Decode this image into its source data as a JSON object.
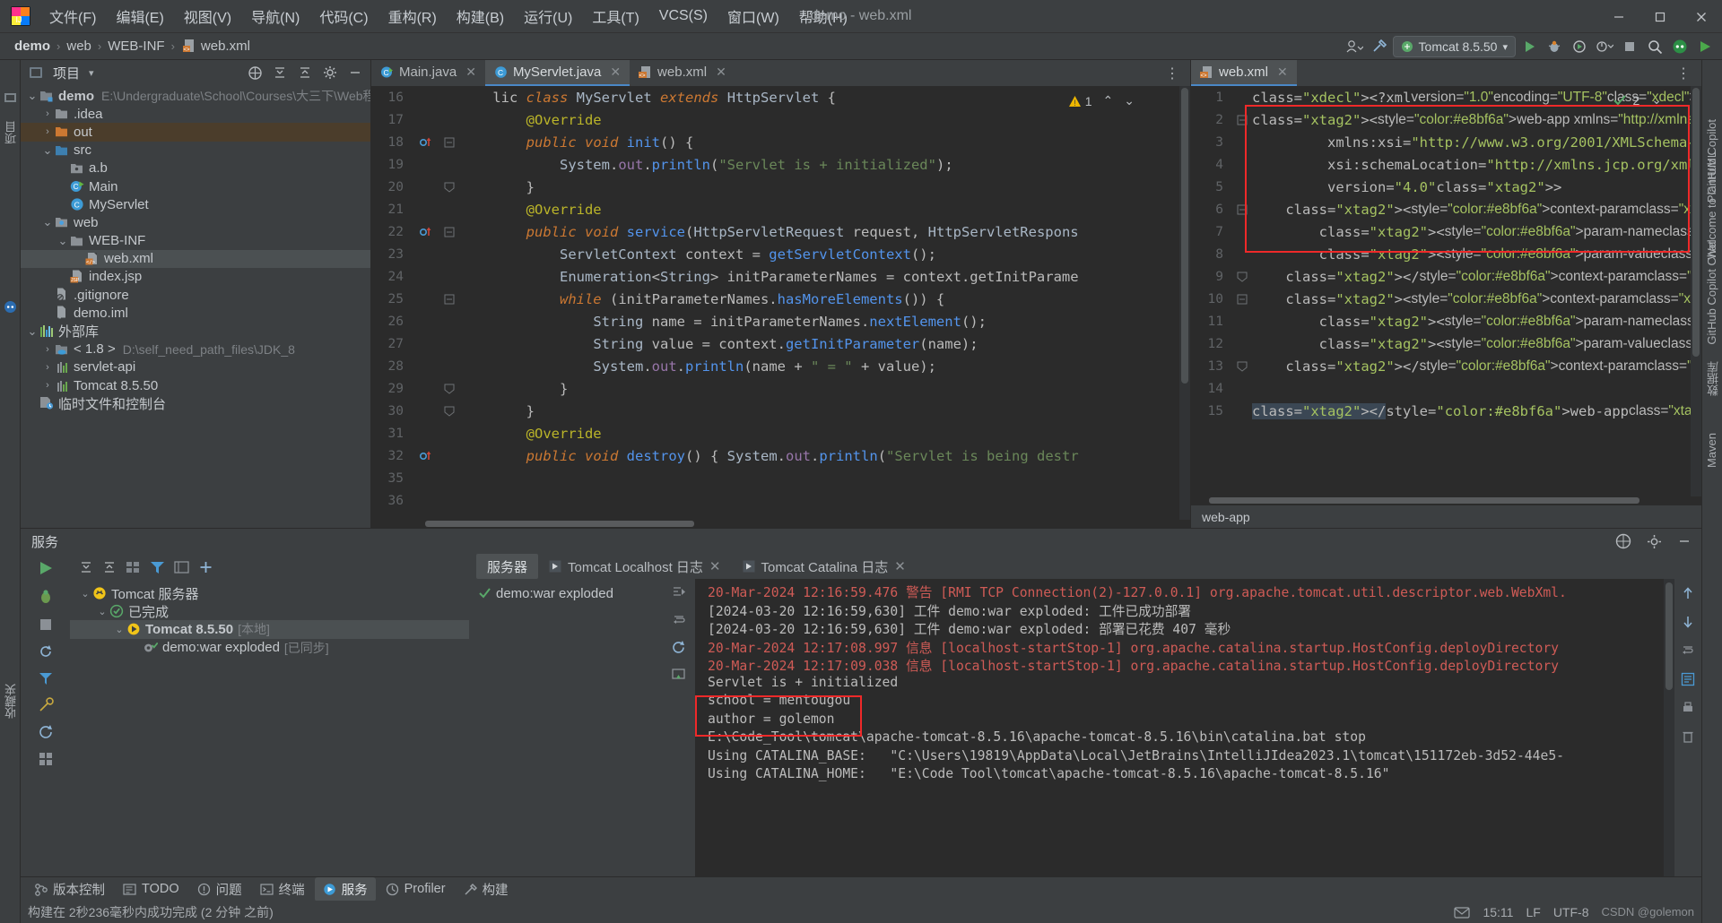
{
  "window": {
    "title": "demo - web.xml",
    "minimize": "—",
    "maximize": "❐",
    "close": "✕"
  },
  "menu": {
    "items": [
      {
        "label": "文件(F)",
        "name": "menu-file"
      },
      {
        "label": "编辑(E)",
        "name": "menu-edit"
      },
      {
        "label": "视图(V)",
        "name": "menu-view"
      },
      {
        "label": "导航(N)",
        "name": "menu-navigate"
      },
      {
        "label": "代码(C)",
        "name": "menu-code"
      },
      {
        "label": "重构(R)",
        "name": "menu-refactor"
      },
      {
        "label": "构建(B)",
        "name": "menu-build"
      },
      {
        "label": "运行(U)",
        "name": "menu-run"
      },
      {
        "label": "工具(T)",
        "name": "menu-tools"
      },
      {
        "label": "VCS(S)",
        "name": "menu-vcs"
      },
      {
        "label": "窗口(W)",
        "name": "menu-window"
      },
      {
        "label": "帮助(H)",
        "name": "menu-help"
      }
    ]
  },
  "navbar": {
    "crumbs": [
      "demo",
      "web",
      "WEB-INF",
      "web.xml"
    ],
    "separator": "›",
    "run_config": "Tomcat 8.5.50",
    "run_config_caret": "▾"
  },
  "left_strip": {
    "tabs": [
      "项目",
      "收藏夹"
    ]
  },
  "right_strip": {
    "tabs": [
      "Welcome to GitHub Copilot",
      "PlantUML",
      "GitHub Copilot Chat",
      "数据库",
      "Maven"
    ]
  },
  "project": {
    "title": "项目",
    "caret": "▾",
    "tree": [
      {
        "indent": 0,
        "arrow": "v",
        "icon": "module-folder",
        "label": "demo",
        "bold": true,
        "path": "E:\\Undergraduate\\School\\Courses\\大三下\\Web程序设计",
        "state": "normal"
      },
      {
        "indent": 1,
        "arrow": ">",
        "icon": "folder-gray",
        "label": ".idea",
        "path": "",
        "state": "normal"
      },
      {
        "indent": 1,
        "arrow": ">",
        "icon": "folder-orange",
        "label": "out",
        "path": "",
        "state": "excluded"
      },
      {
        "indent": 1,
        "arrow": "v",
        "icon": "folder-src",
        "label": "src",
        "path": "",
        "state": "normal"
      },
      {
        "indent": 2,
        "arrow": "",
        "icon": "package",
        "label": "a.b",
        "path": "",
        "state": "normal"
      },
      {
        "indent": 2,
        "arrow": "",
        "icon": "class-run",
        "label": "Main",
        "path": "",
        "state": "normal"
      },
      {
        "indent": 2,
        "arrow": "",
        "icon": "class",
        "label": "MyServlet",
        "path": "",
        "state": "normal"
      },
      {
        "indent": 1,
        "arrow": "v",
        "icon": "folder-web",
        "label": "web",
        "path": "",
        "state": "normal"
      },
      {
        "indent": 2,
        "arrow": "v",
        "icon": "folder-gray",
        "label": "WEB-INF",
        "path": "",
        "state": "normal"
      },
      {
        "indent": 3,
        "arrow": "",
        "icon": "xml-file",
        "label": "web.xml",
        "path": "",
        "state": "selected"
      },
      {
        "indent": 2,
        "arrow": "",
        "icon": "jsp-file",
        "label": "index.jsp",
        "path": "",
        "state": "normal"
      },
      {
        "indent": 1,
        "arrow": "",
        "icon": "gitignore-file",
        "label": ".gitignore",
        "path": "",
        "state": "normal"
      },
      {
        "indent": 1,
        "arrow": "",
        "icon": "iml-file",
        "label": "demo.iml",
        "path": "",
        "state": "normal"
      },
      {
        "indent": 0,
        "arrow": "v",
        "icon": "library-bars",
        "label": "外部库",
        "path": "",
        "state": "normal"
      },
      {
        "indent": 1,
        "arrow": ">",
        "icon": "jdk-folder",
        "label": "< 1.8 >",
        "path": "D:\\self_need_path_files\\JDK_8",
        "state": "normal"
      },
      {
        "indent": 1,
        "arrow": ">",
        "icon": "library-bars-sm",
        "label": "servlet-api",
        "path": "",
        "state": "normal"
      },
      {
        "indent": 1,
        "arrow": ">",
        "icon": "library-bars-sm",
        "label": "Tomcat 8.5.50",
        "path": "",
        "state": "normal"
      },
      {
        "indent": 0,
        "arrow": "",
        "icon": "scratch-file",
        "label": "临时文件和控制台",
        "path": "",
        "state": "normal"
      }
    ]
  },
  "editor_left": {
    "tabs": [
      {
        "label": "Main.java",
        "icon": "class-run-icon",
        "active": false
      },
      {
        "label": "MyServlet.java",
        "icon": "class-icon",
        "active": true
      },
      {
        "label": "web.xml",
        "icon": "xml-icon",
        "active": false
      }
    ],
    "warning_count": "1",
    "warning_up": "⌃",
    "warning_down": "⌄",
    "first_line_number": 16,
    "lines": [
      {
        "n": 16,
        "gutter": "",
        "fold": "",
        "text": "    lic class MyServlet extends HttpServlet {"
      },
      {
        "n": 17,
        "gutter": "",
        "fold": "",
        "text": "        @Override"
      },
      {
        "n": 18,
        "gutter": "override",
        "fold": "-",
        "text": "        public void init() {"
      },
      {
        "n": 19,
        "gutter": "",
        "fold": "",
        "text": "            System.out.println(\"Servlet is + initialized\");"
      },
      {
        "n": 20,
        "gutter": "",
        "fold": "+",
        "text": "        }"
      },
      {
        "n": 21,
        "gutter": "",
        "fold": "",
        "text": "        @Override"
      },
      {
        "n": 22,
        "gutter": "override",
        "fold": "-",
        "text": "        public void service(HttpServletRequest request, HttpServletRespons"
      },
      {
        "n": 23,
        "gutter": "",
        "fold": "",
        "text": "            ServletContext context = getServletContext();"
      },
      {
        "n": 24,
        "gutter": "",
        "fold": "",
        "text": "            Enumeration<String> initParameterNames = context.getInitParame"
      },
      {
        "n": 25,
        "gutter": "",
        "fold": "-",
        "text": "            while (initParameterNames.hasMoreElements()) {"
      },
      {
        "n": 26,
        "gutter": "",
        "fold": "",
        "text": "                String name = initParameterNames.nextElement();"
      },
      {
        "n": 27,
        "gutter": "",
        "fold": "",
        "text": "                String value = context.getInitParameter(name);"
      },
      {
        "n": 28,
        "gutter": "",
        "fold": "",
        "text": "                System.out.println(name + \" = \" + value);"
      },
      {
        "n": 29,
        "gutter": "",
        "fold": "+",
        "text": "            }"
      },
      {
        "n": 30,
        "gutter": "",
        "fold": "+",
        "text": "        }"
      },
      {
        "n": 31,
        "gutter": "",
        "fold": "",
        "text": "        @Override"
      },
      {
        "n": 32,
        "gutter": "override",
        "fold": "",
        "text": "        public void destroy() { System.out.println(\"Servlet is being destr"
      },
      {
        "n": 35,
        "gutter": "",
        "fold": "",
        "text": ""
      },
      {
        "n": 36,
        "gutter": "",
        "fold": "",
        "text": ""
      }
    ]
  },
  "editor_right": {
    "tabs": [
      {
        "label": "web.xml",
        "icon": "xml-icon",
        "active": true
      }
    ],
    "inspection_count": "2",
    "inspection_caret": "⌄",
    "breadcrumb": "web-app",
    "lines": [
      {
        "n": 1,
        "fold": "",
        "text": "<?xml version=\"1.0\" encoding=\"UTF-8\"?>"
      },
      {
        "n": 2,
        "fold": "-",
        "text": "<web-app xmlns=\"http://xmlns.jcp.org/xml/ns/javaee\""
      },
      {
        "n": 3,
        "fold": "",
        "text": "         xmlns:xsi=\"http://www.w3.org/2001/XMLSchema-instance\""
      },
      {
        "n": 4,
        "fold": "",
        "text": "         xsi:schemaLocation=\"http://xmlns.jcp.org/xml/ns/javaee http"
      },
      {
        "n": 5,
        "fold": "",
        "text": "         version=\"4.0\">"
      },
      {
        "n": 6,
        "fold": "-",
        "text": "    <context-param>"
      },
      {
        "n": 7,
        "fold": "",
        "text": "        <param-name>author</param-name>"
      },
      {
        "n": 8,
        "fold": "",
        "text": "        <param-value>golemon</param-value>"
      },
      {
        "n": 9,
        "fold": "+",
        "text": "    </context-param>"
      },
      {
        "n": 10,
        "fold": "-",
        "text": "    <context-param>"
      },
      {
        "n": 11,
        "fold": "",
        "text": "        <param-name>school</param-name>"
      },
      {
        "n": 12,
        "fold": "",
        "text": "        <param-value>mentougou</param-value>"
      },
      {
        "n": 13,
        "fold": "+",
        "text": "    </context-param>"
      },
      {
        "n": 14,
        "fold": "",
        "text": ""
      },
      {
        "n": 15,
        "fold": "",
        "text": "</web-app>"
      }
    ]
  },
  "bottom_panel": {
    "title": "服务",
    "server_tree": [
      {
        "indent": 0,
        "arrow": "v",
        "icon": "tomcat-icon",
        "label": "Tomcat 服务器",
        "suffix": ""
      },
      {
        "indent": 1,
        "arrow": "v",
        "icon": "done-icon",
        "label": "已完成",
        "suffix": ""
      },
      {
        "indent": 2,
        "arrow": "v",
        "icon": "tomcat-run-icon",
        "label": "Tomcat 8.5.50",
        "suffix": "[本地]"
      },
      {
        "indent": 3,
        "arrow": "",
        "icon": "artifact-icon",
        "label": "demo:war exploded",
        "suffix": "[已同步]"
      }
    ],
    "console_tabs": [
      {
        "label": "服务器",
        "active": true
      },
      {
        "label": "Tomcat Localhost 日志",
        "active": false,
        "closable": true
      },
      {
        "label": "Tomcat Catalina 日志",
        "active": false,
        "closable": true
      }
    ],
    "console_left_items": [
      {
        "icon": "check",
        "label": "demo:war exploded"
      }
    ],
    "log_lines": [
      {
        "color": "red",
        "text": "20-Mar-2024 12:16:59.476 警告 [RMI TCP Connection(2)-127.0.0.1] org.apache.tomcat.util.descriptor.web.WebXml."
      },
      {
        "color": "white",
        "text": "[2024-03-20 12:16:59,630] 工件 demo:war exploded: 工件已成功部署"
      },
      {
        "color": "white",
        "text": "[2024-03-20 12:16:59,630] 工件 demo:war exploded: 部署已花费 407 毫秒"
      },
      {
        "color": "red",
        "text": "20-Mar-2024 12:17:08.997 信息 [localhost-startStop-1] org.apache.catalina.startup.HostConfig.deployDirectory"
      },
      {
        "color": "red",
        "text": "20-Mar-2024 12:17:09.038 信息 [localhost-startStop-1] org.apache.catalina.startup.HostConfig.deployDirectory"
      },
      {
        "color": "white",
        "text": "Servlet is + initialized"
      },
      {
        "color": "white",
        "text": "school = mentougou"
      },
      {
        "color": "white",
        "text": "author = golemon"
      },
      {
        "color": "white",
        "text": "E:\\Code_Tool\\tomcat\\apache-tomcat-8.5.16\\apache-tomcat-8.5.16\\bin\\catalina.bat stop"
      },
      {
        "color": "white",
        "text": "Using CATALINA_BASE:   \"C:\\Users\\19819\\AppData\\Local\\JetBrains\\IntelliJIdea2023.1\\tomcat\\151172eb-3d52-44e5-"
      },
      {
        "color": "white",
        "text": "Using CATALINA_HOME:   \"E:\\Code Tool\\tomcat\\apache-tomcat-8.5.16\\apache-tomcat-8.5.16\""
      }
    ]
  },
  "toolwindow_bar": {
    "items": [
      {
        "label": "版本控制",
        "icon": "vcs-icon",
        "active": false
      },
      {
        "label": "TODO",
        "icon": "todo-icon",
        "active": false
      },
      {
        "label": "问题",
        "icon": "problems-icon",
        "active": false
      },
      {
        "label": "终端",
        "icon": "terminal-icon",
        "active": false
      },
      {
        "label": "服务",
        "icon": "services-icon",
        "active": true
      },
      {
        "label": "Profiler",
        "icon": "profiler-icon",
        "active": false
      },
      {
        "label": "构建",
        "icon": "build-icon",
        "active": false
      }
    ]
  },
  "statusbar": {
    "message": "构建在 2秒236毫秒内成功完成 (2 分钟 之前)",
    "time": "15:11",
    "line_separator": "LF",
    "encoding": "UTF-8",
    "watermark": "CSDN @golemon"
  },
  "colors": {
    "accent_blue": "#4a88c7",
    "editor_bg": "#2b2b2b",
    "panel_bg": "#3c3f41",
    "highlight_red": "#ef2929",
    "string_green": "#6a8759",
    "keyword_orange": "#cc7832",
    "xml_tag": "#e8bf6a",
    "run_green": "#59a869"
  }
}
